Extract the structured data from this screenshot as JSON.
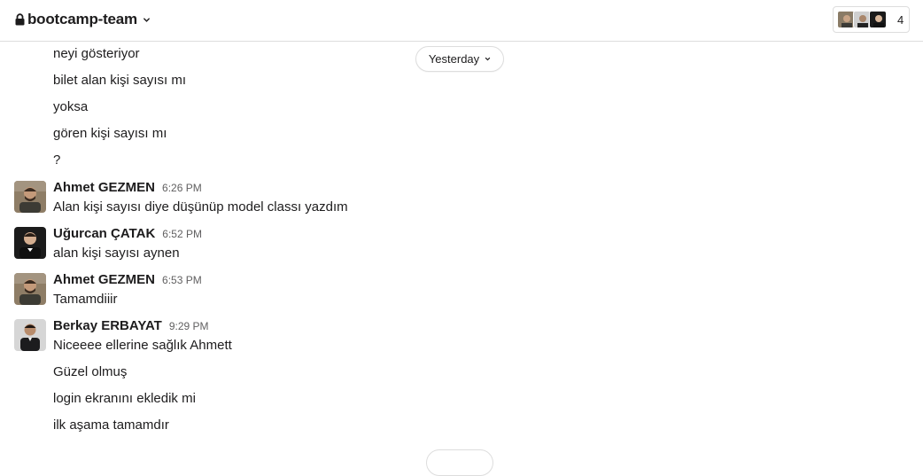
{
  "header": {
    "channel_name": "bootcamp-team",
    "member_count": "4"
  },
  "divider": {
    "label": "Yesterday"
  },
  "messages": {
    "group0": {
      "lines": [
        "neyi gösteriyor",
        "bilet alan kişi sayısı mı",
        "yoksa",
        "gören kişi sayısı mı",
        "?"
      ]
    },
    "m1": {
      "author": "Ahmet GEZMEN",
      "time": "6:26 PM",
      "lines": [
        "Alan kişi sayısı diye düşünüp model classı yazdım"
      ]
    },
    "m2": {
      "author": "Uğurcan ÇATAK",
      "time": "6:52 PM",
      "lines": [
        "alan kişi sayısı aynen"
      ]
    },
    "m3": {
      "author": "Ahmet GEZMEN",
      "time": "6:53 PM",
      "lines": [
        "Tamamdiiir"
      ]
    },
    "m4": {
      "author": "Berkay ERBAYAT",
      "time": "9:29 PM",
      "lines": [
        "Niceeee ellerine sağlık Ahmett",
        "Güzel olmuş",
        "login ekranını ekledik mi",
        "ilk aşama tamamdır"
      ]
    }
  },
  "colors": {
    "text": "#1d1c1d",
    "muted": "#616061",
    "border": "#dddddd"
  }
}
